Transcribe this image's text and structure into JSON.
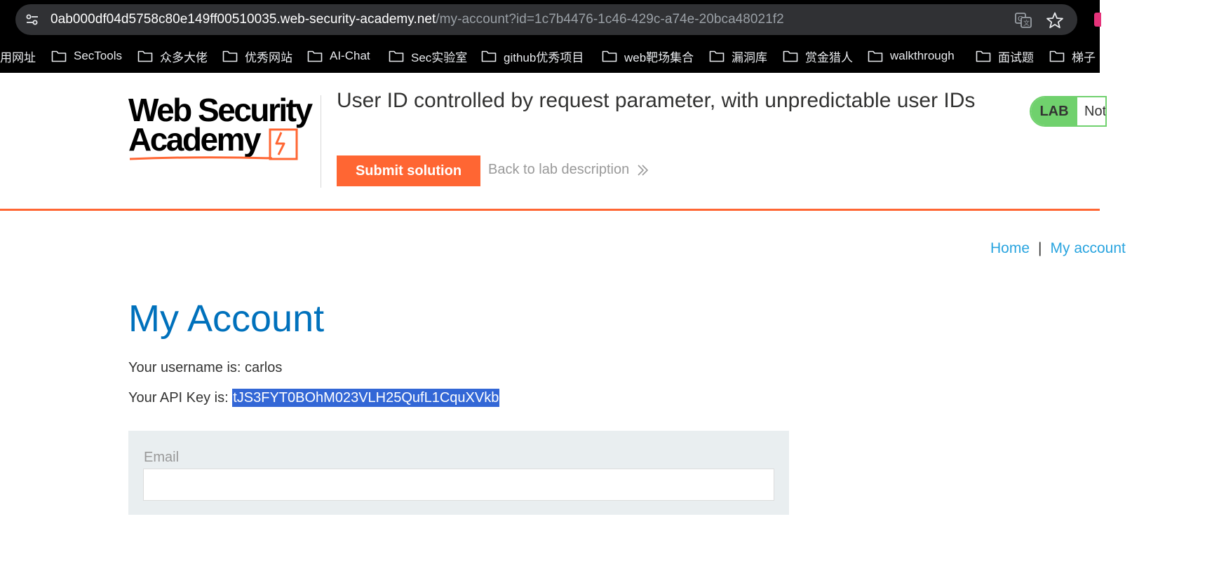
{
  "browser": {
    "url_host": "0ab000df04d5758c80e149ff00510035.web-security-academy.net",
    "url_path": "/my-account?id=1c7b4476-1c46-429c-a74e-20bca48021f2",
    "bookmarks": [
      {
        "label": "用网址"
      },
      {
        "label": "SecTools"
      },
      {
        "label": "众多大佬"
      },
      {
        "label": "优秀网站"
      },
      {
        "label": "AI-Chat"
      },
      {
        "label": "Sec实验室"
      },
      {
        "label": "github优秀项目"
      },
      {
        "label": "web靶场集合"
      },
      {
        "label": "漏洞库"
      },
      {
        "label": "赏金猎人"
      },
      {
        "label": "walkthrough"
      },
      {
        "label": "面试题"
      },
      {
        "label": "梯子"
      }
    ]
  },
  "header": {
    "logo_line1": "Web Security",
    "logo_line2": "Academy",
    "lab_title": "User ID controlled by request parameter, with unpredictable user IDs",
    "submit_label": "Submit solution",
    "back_label": "Back to lab description",
    "lab_badge": "LAB",
    "lab_state": "Not solved"
  },
  "nav": {
    "home": "Home",
    "separator": "|",
    "my_account": "My account"
  },
  "main": {
    "title": "My Account",
    "username_prefix": "Your username is: ",
    "username": "carlos",
    "api_prefix": "Your API Key is: ",
    "api_key": "tJS3FYT0BOhM023VLH25QufL1CquXVkb",
    "email_label": "Email",
    "email_value": ""
  },
  "colors": {
    "accent": "#ff6633",
    "title_blue": "#0071bc",
    "link_blue": "#29a4df",
    "lab_green": "#70d16d",
    "selection": "#3367d6"
  }
}
